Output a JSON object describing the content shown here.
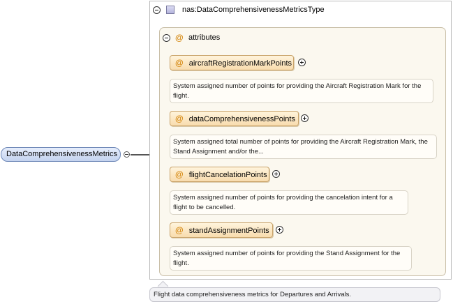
{
  "root": {
    "name": "DataComprehensivenessMetrics",
    "documentation": "Flight data comprehensiveness metrics for Departures and Arrivals."
  },
  "type": {
    "name": "nas:DataComprehensivenessMetricsType"
  },
  "attributes_group": {
    "icon": "@",
    "label": "attributes",
    "items": [
      {
        "name": "aircraftRegistrationMarkPoints",
        "description": "System assigned number of points for providing the Aircraft Registration Mark for the flight."
      },
      {
        "name": "dataComprehensivenessPoints",
        "description": "System assigned total number of points for providing the Aircraft Registration Mark, the Stand Assignment and/or the..."
      },
      {
        "name": "flightCancelationPoints",
        "description": "System assigned number of points for providing the cancelation intent for a flight to be cancelled."
      },
      {
        "name": "standAssignmentPoints",
        "description": "System assigned number of points for providing the Stand Assignment for the flight."
      }
    ]
  }
}
